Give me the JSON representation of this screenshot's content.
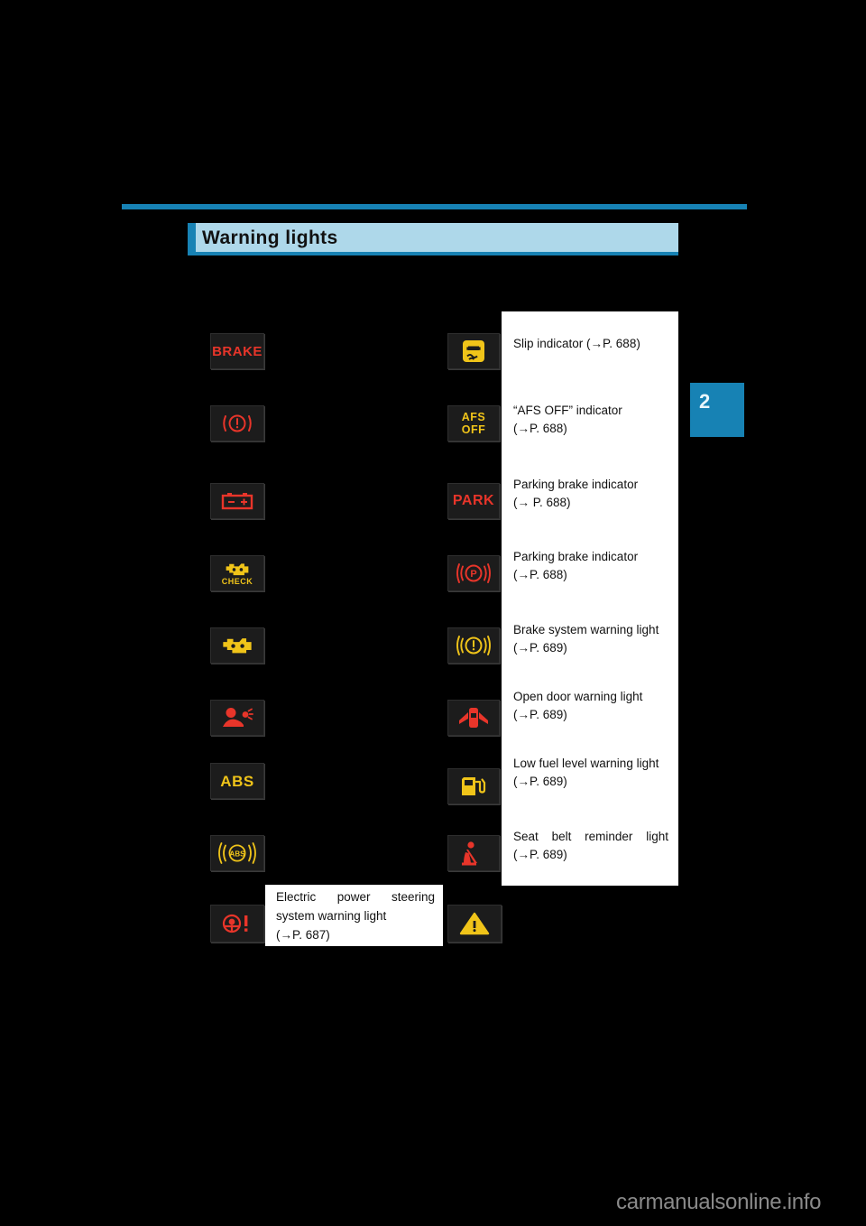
{
  "page": {
    "section_title": "Warning lights",
    "chapter_tab": "2",
    "watermark": "carmanualsonline.info"
  },
  "left_column": [
    {
      "icon": "brake-text-warning-icon",
      "icon_text": "BRAKE",
      "color": "#e8352a"
    },
    {
      "icon": "brake-system-circle-icon",
      "icon_text": "",
      "color": "#e8352a"
    },
    {
      "icon": "charging-battery-icon",
      "icon_text": "",
      "color": "#e8352a"
    },
    {
      "icon": "check-engine-check-icon",
      "icon_text": "CHECK",
      "color": "#f0c419"
    },
    {
      "icon": "malfunction-engine-icon",
      "icon_text": "",
      "color": "#f0c419"
    },
    {
      "icon": "srs-airbag-icon",
      "icon_text": "",
      "color": "#e8352a"
    },
    {
      "icon": "abs-text-icon",
      "icon_text": "ABS",
      "color": "#f0c419"
    },
    {
      "icon": "abs-circle-icon",
      "icon_text": "ABS",
      "color": "#f0c419"
    },
    {
      "icon": "electric-power-steering-icon",
      "icon_text": "",
      "color": "#e8352a"
    }
  ],
  "eps_callout": {
    "line1": "Electric power steering",
    "line2": "system warning light",
    "line3": "(→P. 687)"
  },
  "right_column": [
    {
      "icon": "slip-indicator-icon",
      "icon_text": "",
      "color": "#f0c419",
      "label_line1": "Slip indicator (→P. 688)",
      "label_line2": "",
      "justify": false
    },
    {
      "icon": "afs-off-icon",
      "icon_text": "AFS OFF",
      "color": "#f0c419",
      "label_line1": "“AFS OFF” indicator",
      "label_line2": "(→P. 688)",
      "justify": false
    },
    {
      "icon": "park-text-indicator-icon",
      "icon_text": "PARK",
      "color": "#e8352a",
      "label_line1": "Parking brake indicator",
      "label_line2": "(→ P. 688)",
      "justify": false
    },
    {
      "icon": "parking-brake-circle-icon",
      "icon_text": "",
      "color": "#e8352a",
      "label_line1": "Parking brake indicator",
      "label_line2": "(→P. 688)",
      "justify": false
    },
    {
      "icon": "brake-system-warning-icon",
      "icon_text": "",
      "color": "#f0c419",
      "label_line1": "Brake system warning light",
      "label_line2": "(→P. 689)",
      "justify": false
    },
    {
      "icon": "open-door-icon",
      "icon_text": "",
      "color": "#e8352a",
      "label_line1": "Open door warning light",
      "label_line2": "(→P. 689)",
      "justify": false
    },
    {
      "icon": "low-fuel-icon",
      "icon_text": "",
      "color": "#f0c419",
      "label_line1": "Low fuel level warning light",
      "label_line2": "(→P. 689)",
      "justify": false
    },
    {
      "icon": "seat-belt-reminder-icon",
      "icon_text": "",
      "color": "#e8352a",
      "label_line1": "Seat belt reminder light",
      "label_line2": "(→P. 689)",
      "justify": true
    }
  ],
  "master_warning": {
    "icon": "master-warning-triangle-icon",
    "color": "#f0c419"
  }
}
